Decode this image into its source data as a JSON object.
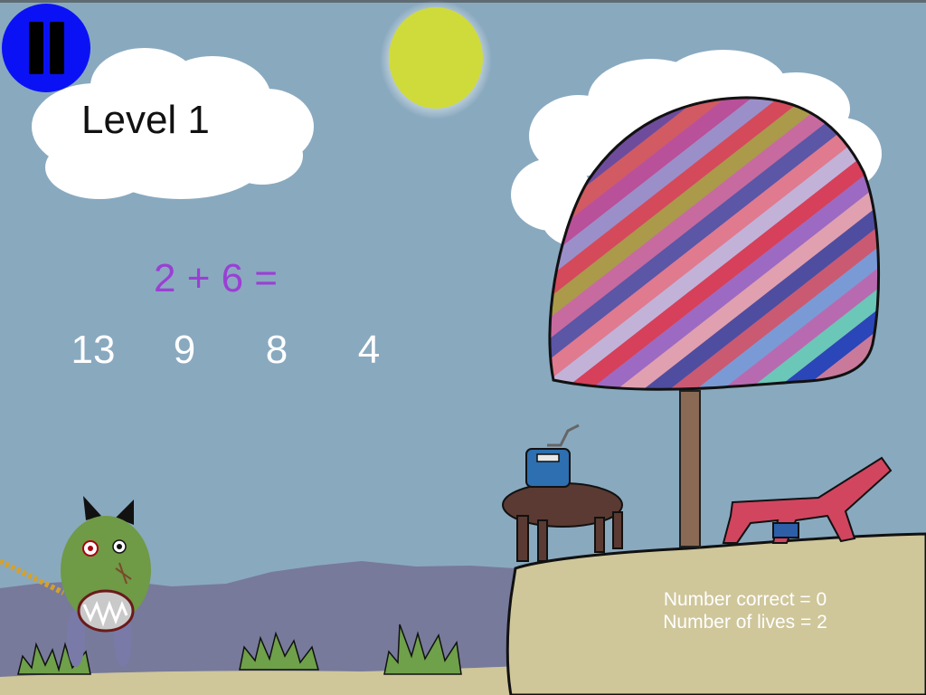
{
  "hud": {
    "level_label": "Level 1",
    "pause_icon": "pause-icon"
  },
  "question": {
    "text": "2 + 6 ="
  },
  "answers": [
    "13",
    "9",
    "8",
    "4"
  ],
  "stats": {
    "correct_line": "Number correct = 0",
    "lives_line": "Number of lives = 2"
  },
  "colors": {
    "sky": "#89a9bf",
    "question": "#9b3fd4",
    "pause_button": "#0a12f5",
    "sun": "#cfdb3a",
    "ground": "#cfc69a"
  }
}
